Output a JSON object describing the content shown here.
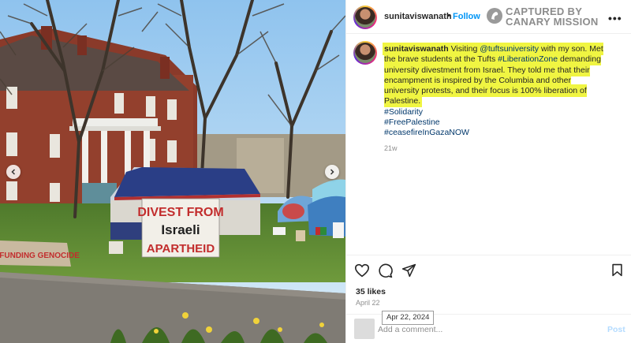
{
  "post": {
    "username": "sunitaviswanath",
    "header_dot": "•",
    "follow_label": "Follow",
    "watermark": {
      "line1": "CAPTURED BY",
      "line2": "CANARY MISSION"
    },
    "more_label": "•••"
  },
  "caption": {
    "username": "sunitaviswanath",
    "text_1": " Visiting ",
    "mention": "@tuftsuniversity",
    "text_2": " with my son. Met the brave students at the Tufts ",
    "hashtag_inline": "#LiberationZone",
    "text_3": " demanding university divestment from Israel. They told me that their encampment is inspired by the Columbia and other university protests, and their focus is 100% liberation of Palestine.",
    "hashtags": [
      "#Solidarity",
      "#FreePalestine",
      "#ceasefireInGazaNOW"
    ],
    "age": "21w"
  },
  "photo": {
    "banner_line1": "DIVEST FROM",
    "banner_line2": "Israeli",
    "banner_line3": "APARTHEID",
    "ground_sign": "IS FUNDING GENOCIDE"
  },
  "actions": {
    "likes": "35 likes",
    "date": "April 22",
    "tooltip": "Apr 22, 2024",
    "comment_placeholder": "Add a comment...",
    "post_label": "Post"
  },
  "colors": {
    "follow": "#0095f6",
    "highlight": "#f0f542",
    "link": "#00376b",
    "post_disabled": "#b3dbff"
  }
}
